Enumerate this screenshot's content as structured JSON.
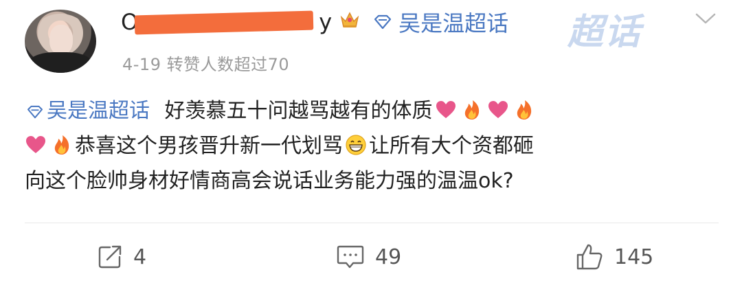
{
  "post": {
    "username_visible_start": "O",
    "username_visible_end": "y",
    "crown_icon": "crown-icon",
    "super_topic_label": "吴是温超话",
    "watermark_text": "超话",
    "meta": "4-19 转赞人数超过70",
    "content": {
      "topic": "吴是温超话",
      "line1_text": "好羡慕五十问越骂越有的体质",
      "line2_text": "恭喜这个男孩晋升新一代划骂",
      "line2_tail": "让所有大个资都砸",
      "line3_text": "向这个脸帅身材好情商高会说话业务能力强的温温ok?"
    },
    "actions": {
      "share_count": "4",
      "comment_count": "49",
      "like_count": "145"
    }
  },
  "colors": {
    "topic_blue": "#4a78c2",
    "meta_gray": "#9a9a9a",
    "redaction_orange": "#f36d3c"
  }
}
